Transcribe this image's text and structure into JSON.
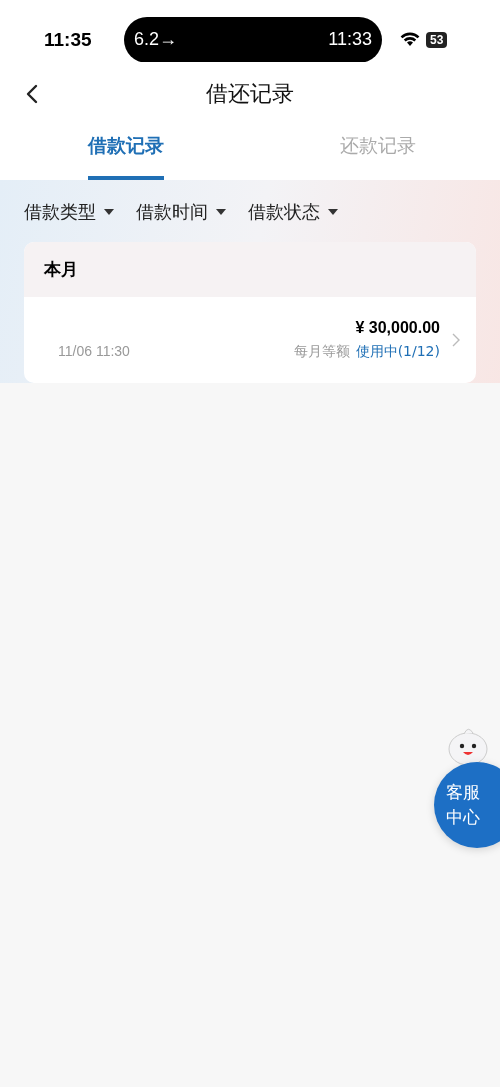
{
  "status_bar": {
    "time": "11:35",
    "island_left": "6.2→",
    "island_right": "11:33",
    "battery": "53"
  },
  "header": {
    "title": "借还记录"
  },
  "tabs": [
    {
      "label": "借款记录",
      "selected": true
    },
    {
      "label": "还款记录",
      "selected": false
    }
  ],
  "filters": [
    {
      "label": "借款类型"
    },
    {
      "label": "借款时间"
    },
    {
      "label": "借款状态"
    }
  ],
  "groups": [
    {
      "title": "本月",
      "records": [
        {
          "date": "11/06 11:30",
          "amount": "¥ 30,000.00",
          "plan": "每月等额",
          "status": "使用中(1/12)"
        }
      ]
    }
  ],
  "service_button": {
    "label": "客服中心"
  }
}
